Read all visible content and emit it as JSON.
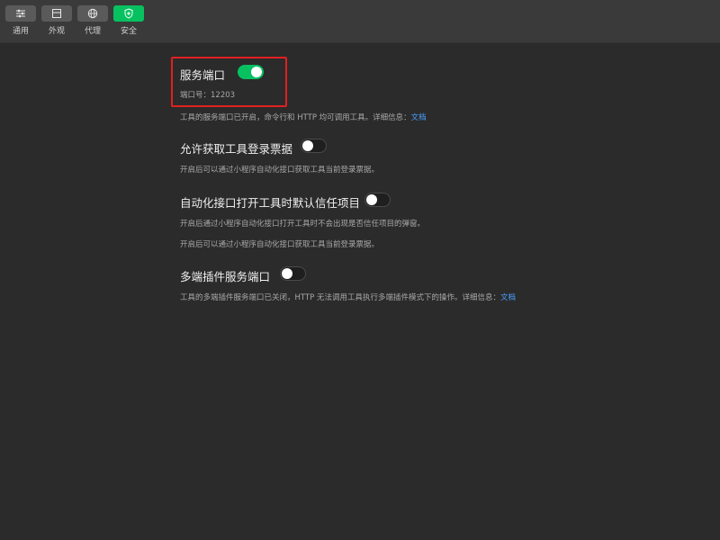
{
  "toolbar": {
    "items": [
      {
        "label": "通用",
        "icon": "sliders-icon"
      },
      {
        "label": "外观",
        "icon": "window-icon"
      },
      {
        "label": "代理",
        "icon": "globe-icon"
      },
      {
        "label": "安全",
        "icon": "shield-icon",
        "active": true
      }
    ]
  },
  "settings": {
    "service_port": {
      "title": "服务端口",
      "enabled": true,
      "port_label": "端口号：12203",
      "desc": "工具的服务端口已开启，命令行和 HTTP 均可调用工具。详细信息：",
      "link": "文档"
    },
    "login_ticket": {
      "title": "允许获取工具登录票据",
      "enabled": false,
      "desc": "开启后可以通过小程序自动化接口获取工具当前登录票据。"
    },
    "auto_trust": {
      "title": "自动化接口打开工具时默认信任项目",
      "enabled": false,
      "desc1": "开启后通过小程序自动化接口打开工具时不会出现是否信任项目的弹窗。",
      "desc2": "开启后可以通过小程序自动化接口获取工具当前登录票据。"
    },
    "multi_plugin": {
      "title": "多端插件服务端口",
      "enabled": false,
      "desc": "工具的多端插件服务端口已关闭，HTTP 无法调用工具执行多端插件模式下的操作。详细信息：",
      "link": "文档"
    }
  },
  "colors": {
    "accent": "#07c160",
    "link": "#4a9fff",
    "highlight": "#e02020",
    "background": "#2b2b2b"
  }
}
